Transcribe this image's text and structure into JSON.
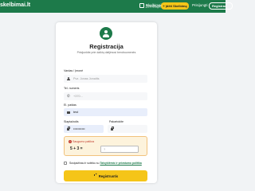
{
  "header": {
    "logo_text": "skelbimai.lt",
    "nav": {
      "map": "Žemėlapis",
      "favorites": "Skelbimai",
      "publish": "+ Įdėti Skelbimą",
      "login": "Prisijungti",
      "register": "Registrac"
    }
  },
  "form": {
    "title": "Registracija",
    "subtitle": "Prisijunkite prie daiktų dalijimosi bendruomenės",
    "name_label": "Vardas / Įmonė",
    "name_placeholder": "Pvz. Jonas Jonaitis",
    "phone_label": "Tel. numeris",
    "phone_placeholder": "+370...",
    "email_label": "El. paštas",
    "email_value": "test",
    "password_label": "Slaptažodis",
    "password_value": "•••••••••••",
    "repeat_label": "Pakartokite",
    "repeat_value": "",
    "captcha": {
      "title": "Saugumo patikra",
      "question": "5 + 3 =",
      "answer_placeholder": "?"
    },
    "terms": {
      "prefix": "Susipažinau ir sutinku su",
      "link": "Taisyklėmis ir privatumo politika"
    },
    "submit_label": "Registruotis"
  },
  "colors": {
    "brand_green": "#1d7a4a",
    "accent_yellow": "#f5c518",
    "captcha_bg": "#fdf3dc",
    "warning_red": "#c0392b"
  }
}
